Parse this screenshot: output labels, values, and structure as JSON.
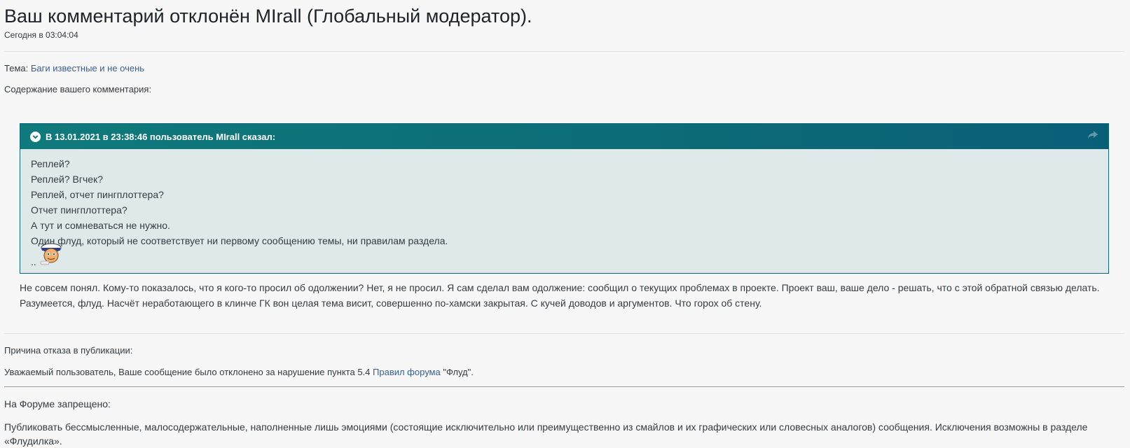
{
  "header": {
    "title": "Ваш комментарий отклонён MIrall (Глобальный модератор).",
    "timestamp": "Сегодня в 03:04:04"
  },
  "topic": {
    "label": "Тема:",
    "link": "Баги известные и не очень"
  },
  "content_label": "Содержание вашего комментария:",
  "quote": {
    "header": "В 13.01.2021 в 23:38:46 пользователь MIrall сказал:",
    "expand_icon": "chevron-down-icon",
    "share_icon": "share-icon",
    "lines": [
      "Реплей?",
      "Реплей? Вгчек?",
      "Реплей, отчет пингплоттера?",
      "Отчет пингплоттера?",
      "А тут и сомневаться не нужно.",
      "Один флуд, который не соответствует ни первому сообщению темы, ни правилам раздела."
    ],
    "trailing": "..",
    "emoji": "sailor-smiley"
  },
  "comment_lines": [
    "Не совсем понял. Кому-то показалось, что я кого-то просил об одолжении? Нет, я не просил. Я сам сделал вам одолжение: сообщил о текущих проблемах в проекте. Проект ваш, ваше дело - решать, что с этой обратной связью делать.",
    "Разумеется, флуд. Насчёт неработающего в клинче ГК вон целая тема висит, совершенно по-хамски закрытая. С кучей доводов и аргументов. Что горох об стену."
  ],
  "reason": {
    "label": "Причина отказа в публикации:",
    "text_before": "Уважаемый пользователь, Ваше сообщение было отклонено за нарушение пункта 5.4 ",
    "rules_link": "Правил форума",
    "text_after": " \"Флуд\"."
  },
  "rules": {
    "heading": "На Форуме запрещено:",
    "line1": "Публиковать бессмысленные, малосодержательные, наполненные лишь эмоциями (состоящие исключительно или преимущественно из смайлов и их графических или словесных аналогов) сообщения. Исключения возможны в разделе",
    "line2": "«Флудилка»."
  },
  "colors": {
    "quote_header": "#0c6b77",
    "quote_bg": "#dfe9ea",
    "link": "#385f94"
  }
}
